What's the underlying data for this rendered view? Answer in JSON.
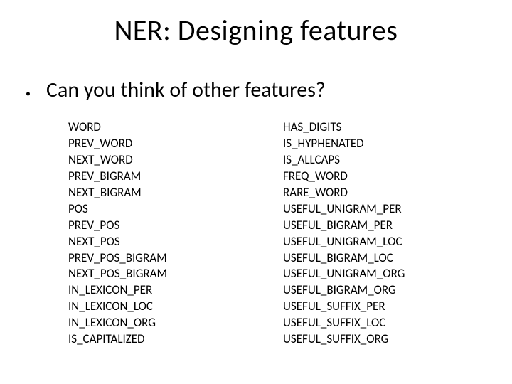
{
  "title": "NER: Designing features",
  "bullet": "Can you think of other features?",
  "left_features": [
    "WORD",
    "PREV_WORD",
    "NEXT_WORD",
    "PREV_BIGRAM",
    "NEXT_BIGRAM",
    "POS",
    "PREV_POS",
    "NEXT_POS",
    "PREV_POS_BIGRAM",
    "NEXT_POS_BIGRAM",
    "IN_LEXICON_PER",
    "IN_LEXICON_LOC",
    "IN_LEXICON_ORG",
    "IS_CAPITALIZED"
  ],
  "right_features": [
    "HAS_DIGITS",
    "IS_HYPHENATED",
    "IS_ALLCAPS",
    "FREQ_WORD",
    "RARE_WORD",
    "USEFUL_UNIGRAM_PER",
    "USEFUL_BIGRAM_PER",
    "USEFUL_UNIGRAM_LOC",
    "USEFUL_BIGRAM_LOC",
    "USEFUL_UNIGRAM_ORG",
    "USEFUL_BIGRAM_ORG",
    "USEFUL_SUFFIX_PER",
    "USEFUL_SUFFIX_LOC",
    "USEFUL_SUFFIX_ORG"
  ]
}
